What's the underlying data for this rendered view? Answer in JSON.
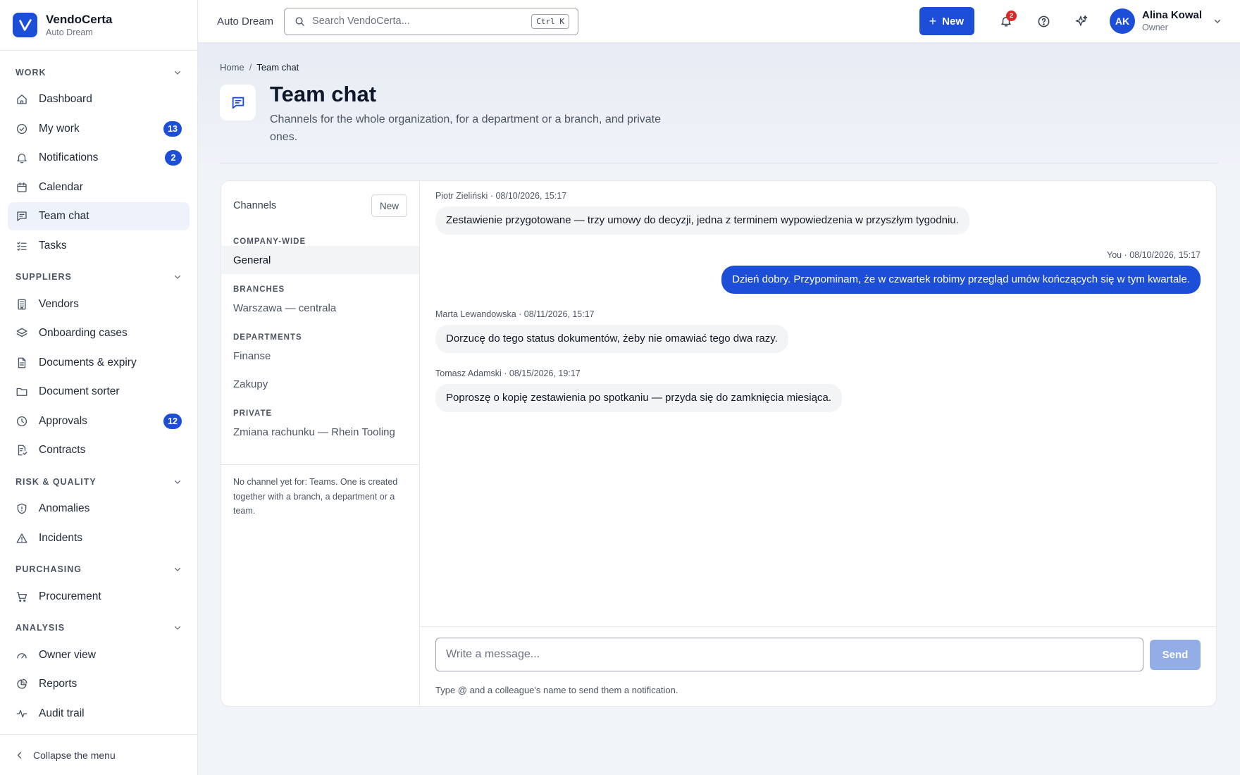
{
  "brand": {
    "name": "VendoCerta",
    "org": "Auto Dream"
  },
  "sidebar": {
    "sections": [
      {
        "label": "WORK",
        "items": [
          {
            "icon": "home-icon",
            "label": "Dashboard",
            "badge": ""
          },
          {
            "icon": "check-circle-icon",
            "label": "My work",
            "badge": "13"
          },
          {
            "icon": "bell-icon",
            "label": "Notifications",
            "badge": "2"
          },
          {
            "icon": "calendar-icon",
            "label": "Calendar",
            "badge": ""
          },
          {
            "icon": "chat-icon",
            "label": "Team chat",
            "badge": "",
            "active": true
          },
          {
            "icon": "tasks-icon",
            "label": "Tasks",
            "badge": ""
          }
        ]
      },
      {
        "label": "SUPPLIERS",
        "items": [
          {
            "icon": "building-icon",
            "label": "Vendors",
            "badge": ""
          },
          {
            "icon": "layers-icon",
            "label": "Onboarding cases",
            "badge": ""
          },
          {
            "icon": "document-icon",
            "label": "Documents & expiry",
            "badge": ""
          },
          {
            "icon": "folder-icon",
            "label": "Document sorter",
            "badge": ""
          },
          {
            "icon": "clock-icon",
            "label": "Approvals",
            "badge": "12"
          },
          {
            "icon": "contract-icon",
            "label": "Contracts",
            "badge": ""
          }
        ]
      },
      {
        "label": "RISK & QUALITY",
        "items": [
          {
            "icon": "shield-icon",
            "label": "Anomalies",
            "badge": ""
          },
          {
            "icon": "warning-icon",
            "label": "Incidents",
            "badge": ""
          }
        ]
      },
      {
        "label": "PURCHASING",
        "items": [
          {
            "icon": "cart-icon",
            "label": "Procurement",
            "badge": ""
          }
        ]
      },
      {
        "label": "ANALYSIS",
        "items": [
          {
            "icon": "gauge-icon",
            "label": "Owner view",
            "badge": ""
          },
          {
            "icon": "pie-chart-icon",
            "label": "Reports",
            "badge": ""
          },
          {
            "icon": "activity-icon",
            "label": "Audit trail",
            "badge": ""
          }
        ]
      }
    ],
    "collapse_label": "Collapse the menu"
  },
  "topbar": {
    "org": "Auto Dream",
    "search_placeholder": "Search VendoCerta...",
    "search_shortcut": "Ctrl K",
    "new_label": "New",
    "notifications_count": "2",
    "user": {
      "initials": "AK",
      "name": "Alina Kowal",
      "role": "Owner"
    }
  },
  "page": {
    "breadcrumb": {
      "home": "Home",
      "current": "Team chat"
    },
    "title": "Team chat",
    "description": "Channels for the whole organization, for a department or a branch, and private ones."
  },
  "channels": {
    "title": "Channels",
    "new_label": "New",
    "groups": [
      {
        "label": "COMPANY-WIDE",
        "items": [
          {
            "label": "General",
            "active": true
          }
        ]
      },
      {
        "label": "BRANCHES",
        "items": [
          {
            "label": "Warszawa — centrala"
          }
        ]
      },
      {
        "label": "DEPARTMENTS",
        "items": [
          {
            "label": "Finanse"
          },
          {
            "label": "Zakupy"
          }
        ]
      },
      {
        "label": "PRIVATE",
        "items": [
          {
            "label": "Zmiana rachunku — Rhein Tooling"
          }
        ]
      }
    ],
    "note": "No channel yet for: Teams. One is created together with a branch, a department or a team."
  },
  "messages": [
    {
      "author": "Piotr Zieliński",
      "time": "08/10/2026, 15:17",
      "text": "Zestawienie przygotowane — trzy umowy do decyzji, jedna z terminem wypowiedzenia w przyszłym tygodniu.",
      "mine": false
    },
    {
      "author": "You",
      "time": "08/10/2026, 15:17",
      "text": "Dzień dobry. Przypominam, że w czwartek robimy przegląd umów kończących się w tym kwartale.",
      "mine": true
    },
    {
      "author": "Marta Lewandowska",
      "time": "08/11/2026, 15:17",
      "text": "Dorzucę do tego status dokumentów, żeby nie omawiać tego dwa razy.",
      "mine": false
    },
    {
      "author": "Tomasz Adamski",
      "time": "08/15/2026, 19:17",
      "text": "Poproszę o kopię zestawienia po spotkaniu — przyda się do zamknięcia miesiąca.",
      "mine": false
    }
  ],
  "composer": {
    "placeholder": "Write a message...",
    "send_label": "Send",
    "hint": "Type @ and a colleague's name to send them a notification."
  },
  "colors": {
    "accent": "#1d4ed8",
    "danger": "#dc2626",
    "send_disabled": "#93aee6"
  }
}
